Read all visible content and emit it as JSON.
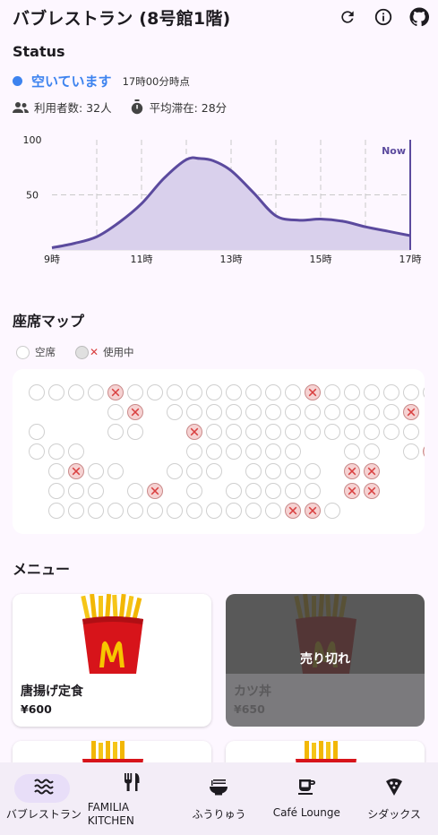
{
  "app": {
    "title": "バブレストラン (8号館1階)"
  },
  "status": {
    "heading": "Status",
    "state": "空いています",
    "as_of": "17時00分時点",
    "users": "利用者数: 32人",
    "avg_stay": "平均滞在: 28分",
    "color": "#3d83ef"
  },
  "chart_data": {
    "type": "area",
    "x_ticks": [
      "9時",
      "11時",
      "13時",
      "15時",
      "17時"
    ],
    "y_ticks": [
      "50",
      "100"
    ],
    "ylim": [
      0,
      100
    ],
    "xlim": [
      9,
      17
    ],
    "annotation": "Now",
    "x": [
      9.0,
      9.5,
      10.0,
      10.5,
      11.0,
      11.5,
      12.0,
      12.3,
      12.6,
      13.0,
      13.5,
      14.0,
      14.5,
      15.0,
      15.5,
      16.0,
      16.5,
      17.0
    ],
    "y": [
      2,
      6,
      12,
      25,
      42,
      65,
      82,
      83,
      81,
      72,
      52,
      31,
      27,
      28,
      26,
      21,
      17,
      13
    ],
    "color": "#5b4a9e",
    "fill": "#d9d0ec"
  },
  "seats": {
    "heading": "座席マップ",
    "legend_free": "空席",
    "legend_used": "使用中",
    "rows": [
      "ooooxoooooooooxoooooo",
      "____ox_oooooooooooox",
      "o___oo__xooooooooooo",
      "ooo_____oooooo__oo_ox",
      "_oxoo__ooo_oooo_xx___",
      "_ooo_ox_o_ooooo_xx___",
      "_ooooooooooooxxo_____"
    ]
  },
  "menu": {
    "heading": "メニュー",
    "items": [
      {
        "name": "唐揚げ定食",
        "price": "¥600",
        "sold_out": false
      },
      {
        "name": "カツ丼",
        "price": "¥650",
        "sold_out": true,
        "sold_label": "売り切れ"
      }
    ]
  },
  "nav": {
    "items": [
      {
        "label": "バブレストラン",
        "icon": "waves-icon",
        "active": true
      },
      {
        "label1": "FAMILIA",
        "label2": "KITCHEN",
        "icon": "fork-knife-icon"
      },
      {
        "label": "ふうりゅう",
        "icon": "ramen-bowl-icon"
      },
      {
        "label": "Café Lounge",
        "icon": "coffee-cup-icon"
      },
      {
        "label": "シダックス",
        "icon": "pizza-slice-icon"
      }
    ]
  }
}
